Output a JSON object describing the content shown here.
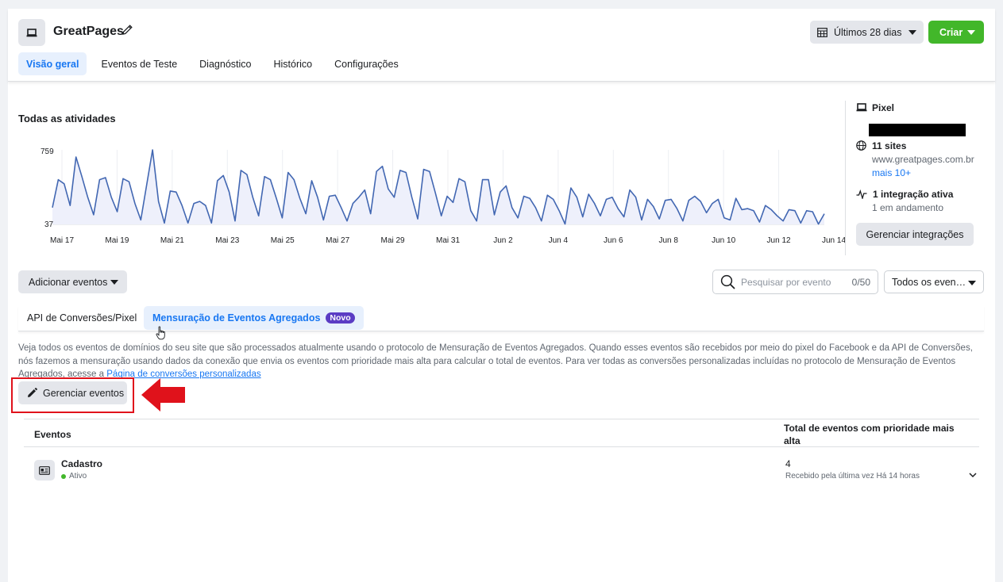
{
  "header": {
    "app_title": "GreatPages",
    "app_icon": "laptop-icon",
    "tabs": [
      {
        "label": "Visão geral",
        "active": true
      },
      {
        "label": "Eventos de Teste",
        "active": false
      },
      {
        "label": "Diagnóstico",
        "active": false
      },
      {
        "label": "Histórico",
        "active": false
      },
      {
        "label": "Configurações",
        "active": false
      }
    ],
    "date_range": "Últimos 28 dias",
    "create_label": "Criar"
  },
  "activity": {
    "title": "Todas as atividades"
  },
  "chart_data": {
    "type": "area",
    "title": "Todas as atividades",
    "ylim": [
      37,
      759
    ],
    "yticks": [
      "759",
      "37"
    ],
    "xticks": [
      "Mai 17",
      "Mai 19",
      "Mai 21",
      "Mai 23",
      "Mai 25",
      "Mai 27",
      "Mai 29",
      "Mai 31",
      "Jun 2",
      "Jun 4",
      "Jun 6",
      "Jun 8",
      "Jun 10",
      "Jun 12",
      "Jun 14"
    ],
    "color": "#4267b2",
    "fill": "#eef0fb",
    "values": [
      200,
      470,
      430,
      220,
      690,
      500,
      300,
      130,
      470,
      490,
      300,
      160,
      480,
      450,
      240,
      80,
      420,
      759,
      260,
      50,
      360,
      350,
      220,
      50,
      240,
      260,
      220,
      50,
      460,
      510,
      350,
      70,
      560,
      520,
      300,
      120,
      500,
      470,
      290,
      100,
      540,
      470,
      290,
      140,
      460,
      300,
      80,
      310,
      320,
      200,
      70,
      240,
      300,
      370,
      140,
      550,
      600,
      380,
      300,
      560,
      540,
      300,
      90,
      570,
      550,
      340,
      120,
      310,
      250,
      480,
      450,
      170,
      70,
      470,
      470,
      130,
      350,
      410,
      200,
      100,
      310,
      290,
      200,
      70,
      320,
      280,
      170,
      40,
      390,
      300,
      110,
      330,
      240,
      120,
      280,
      300,
      190,
      110,
      370,
      300,
      80,
      280,
      210,
      90,
      270,
      280,
      190,
      70,
      270,
      310,
      260,
      150,
      240,
      280,
      100,
      80,
      290,
      180,
      190,
      170,
      60,
      220,
      180,
      120,
      70,
      180,
      170,
      50,
      170,
      160,
      40,
      140
    ]
  },
  "pixel_panel": {
    "pixel_label": "Pixel",
    "sites_label": "11 sites",
    "site_url": "www.greatpages.com.br",
    "more_link": "mais 10+",
    "integration_label": "1 integração ativa",
    "integration_status": "1 em andamento",
    "manage_integrations": "Gerenciar integrações"
  },
  "toolbar": {
    "add_events": "Adicionar eventos",
    "search_placeholder": "Pesquisar por evento",
    "search_count": "0/50",
    "filter_label": "Todos os even…"
  },
  "subtabs": {
    "api_label": "API de Conversões/Pixel",
    "aem_label": "Mensuração de Eventos Agregados",
    "new_badge": "Novo"
  },
  "description": {
    "text": "Veja todos os eventos de domínios do seu site que são processados atualmente usando o protocolo de Mensuração de Eventos Agregados. Quando esses eventos são recebidos por meio do pixel do Facebook e da API de Conversões, nós fazemos a mensuração usando dados da conexão que envia os eventos com prioridade mais alta para calcular o total de eventos. Para ver todas as conversões personalizadas incluídas no protocolo de Mensuração de Eventos Agregados, acesse a ",
    "link": "Página de conversões personalizadas"
  },
  "manage_events": "Gerenciar eventos",
  "table": {
    "col_events": "Eventos",
    "col_total": "Total de eventos com prioridade mais alta",
    "rows": [
      {
        "name": "Cadastro",
        "status": "Ativo",
        "count": "4",
        "received": "Recebido pela última vez Há 14 horas"
      }
    ]
  }
}
